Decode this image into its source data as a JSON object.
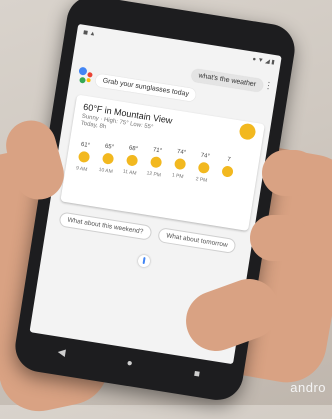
{
  "conversation": {
    "query": "what's the weather",
    "greeting": "Grab your sunglasses today"
  },
  "weather_card": {
    "title": "60°F in Mountain View",
    "summary": "Sunny · High: 75° Low: 55°",
    "subinfo": "Today, 8h",
    "forecast": [
      {
        "temp": "61°",
        "time": "9 AM"
      },
      {
        "temp": "65°",
        "time": "10 AM"
      },
      {
        "temp": "68°",
        "time": "11 AM"
      },
      {
        "temp": "71°",
        "time": "12 PM"
      },
      {
        "temp": "74°",
        "time": "1 PM"
      },
      {
        "temp": "74°",
        "time": "2 PM"
      },
      {
        "temp": "7",
        "time": ""
      }
    ]
  },
  "suggestions": [
    "What about this weekend?",
    "What about tomorrow"
  ],
  "brand_colors": {
    "assistant_blue": "#4285f4",
    "assistant_red": "#ea4335",
    "assistant_yellow": "#fbbc05",
    "assistant_green": "#34a853",
    "sun": "#f2b81f"
  },
  "navigation": {
    "back_icon": "back-icon",
    "home_icon": "home-icon",
    "recents_icon": "recents-icon"
  },
  "watermark": "andro"
}
